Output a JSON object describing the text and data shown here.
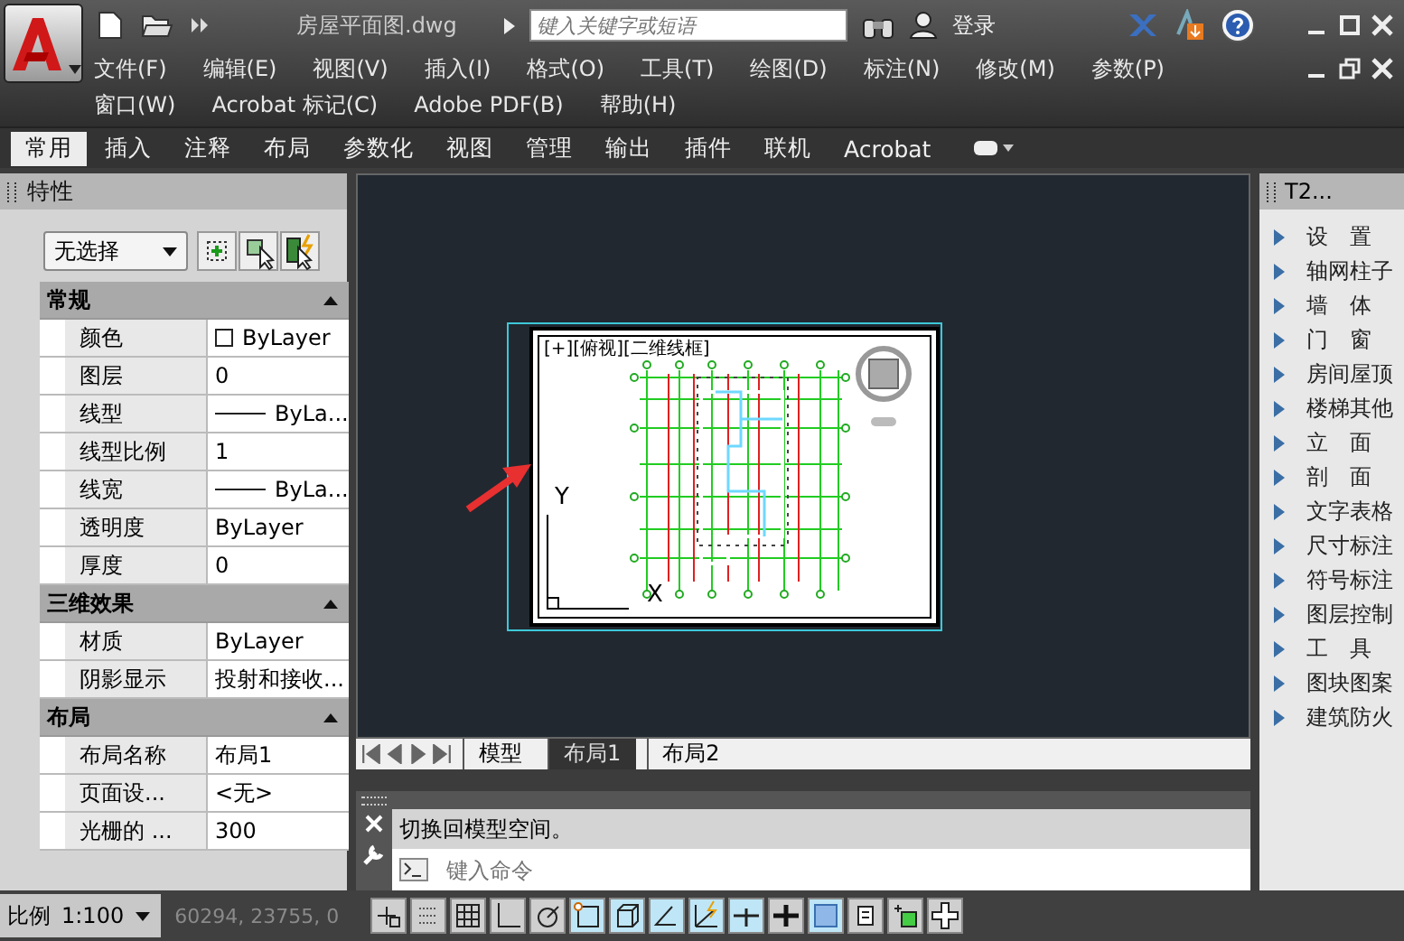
{
  "window": {
    "title": "房屋平面图.dwg"
  },
  "search": {
    "placeholder": "键入关键字或短语"
  },
  "login": "登录",
  "menus": [
    [
      "文件(F)",
      "编辑(E)",
      "视图(V)",
      "插入(I)",
      "格式(O)",
      "工具(T)",
      "绘图(D)",
      "标注(N)",
      "修改(M)",
      "参数(P)"
    ],
    [
      "窗口(W)",
      "Acrobat 标记(C)",
      "Adobe PDF(B)",
      "帮助(H)"
    ]
  ],
  "ribbon_tabs": [
    {
      "label": "常用",
      "selected": true
    },
    {
      "label": "插入",
      "selected": false
    },
    {
      "label": "注释",
      "selected": false
    },
    {
      "label": "布局",
      "selected": false
    },
    {
      "label": "参数化",
      "selected": false
    },
    {
      "label": "视图",
      "selected": false
    },
    {
      "label": "管理",
      "selected": false
    },
    {
      "label": "输出",
      "selected": false
    },
    {
      "label": "插件",
      "selected": false
    },
    {
      "label": "联机",
      "selected": false
    },
    {
      "label": "Acrobat",
      "selected": false
    }
  ],
  "properties": {
    "title": "特性",
    "selection": "无选择",
    "sections": [
      {
        "title": "常规",
        "rows": [
          {
            "label": "颜色",
            "value": "ByLayer",
            "kind": "swatch"
          },
          {
            "label": "图层",
            "value": "0",
            "kind": "text"
          },
          {
            "label": "线型",
            "value": "ByLa...",
            "kind": "line"
          },
          {
            "label": "线型比例",
            "value": "1",
            "kind": "text"
          },
          {
            "label": "线宽",
            "value": "ByLa...",
            "kind": "line"
          },
          {
            "label": "透明度",
            "value": "ByLayer",
            "kind": "text"
          },
          {
            "label": "厚度",
            "value": "0",
            "kind": "text"
          }
        ]
      },
      {
        "title": "三维效果",
        "rows": [
          {
            "label": "材质",
            "value": "ByLayer",
            "kind": "text"
          },
          {
            "label": "阴影显示",
            "value": "投射和接收...",
            "kind": "text"
          }
        ]
      },
      {
        "title": "布局",
        "rows": [
          {
            "label": "布局名称",
            "value": "布局1",
            "kind": "text"
          },
          {
            "label": "页面设...",
            "value": "<无>",
            "kind": "text"
          },
          {
            "label": "光栅的 ...",
            "value": "300",
            "kind": "text"
          }
        ]
      }
    ]
  },
  "canvas": {
    "view_label": "[+][俯视][二维线框]",
    "axis_x": "X",
    "axis_y": "Y"
  },
  "layout_tabs": [
    {
      "label": "模型",
      "selected": false
    },
    {
      "label": "布局1",
      "selected": true
    },
    {
      "label": "布局2",
      "selected": false
    }
  ],
  "command": {
    "history": "切换回模型空间。",
    "placeholder": "键入命令"
  },
  "tool_palette": {
    "title": "T2...",
    "items": [
      "设　置",
      "轴网柱子",
      "墙　体",
      "门　窗",
      "房间屋顶",
      "楼梯其他",
      "立　面",
      "剖　面",
      "文字表格",
      "尺寸标注",
      "符号标注",
      "图层控制",
      "工　具",
      "图块图案",
      "建筑防火"
    ]
  },
  "status_bar": {
    "scale_label": "比例",
    "scale": "1:100",
    "coordinates": "60294, 23755, 0",
    "toggles": [
      {
        "kind": "infer",
        "on": false
      },
      {
        "kind": "snap",
        "on": false
      },
      {
        "kind": "grid",
        "on": false
      },
      {
        "kind": "ortho",
        "on": false
      },
      {
        "kind": "polar",
        "on": false
      },
      {
        "kind": "osnap",
        "on": true
      },
      {
        "kind": "osnap3d",
        "on": true
      },
      {
        "kind": "otrack",
        "on": true
      },
      {
        "kind": "ducs",
        "on": true
      },
      {
        "kind": "dyn",
        "on": true
      },
      {
        "kind": "lwt",
        "on": false
      },
      {
        "kind": "transparency",
        "on": true
      },
      {
        "kind": "qp",
        "on": false
      },
      {
        "kind": "sc",
        "on": false
      },
      {
        "kind": "plus",
        "on": false
      }
    ]
  }
}
